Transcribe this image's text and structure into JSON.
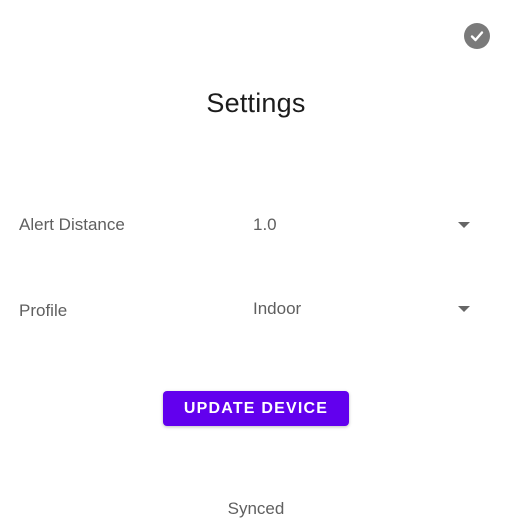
{
  "header": {
    "title": "Settings",
    "confirm_icon": "check-circle-icon"
  },
  "settings": {
    "alert_distance": {
      "label": "Alert Distance",
      "value": "1.0"
    },
    "profile": {
      "label": "Profile",
      "value": "Indoor"
    }
  },
  "actions": {
    "update_label": "UPDATE DEVICE"
  },
  "status": {
    "text": "Synced"
  },
  "colors": {
    "accent": "#6200ee",
    "icon_gray": "#7a7a7a",
    "text_gray": "#5f5f5f"
  }
}
